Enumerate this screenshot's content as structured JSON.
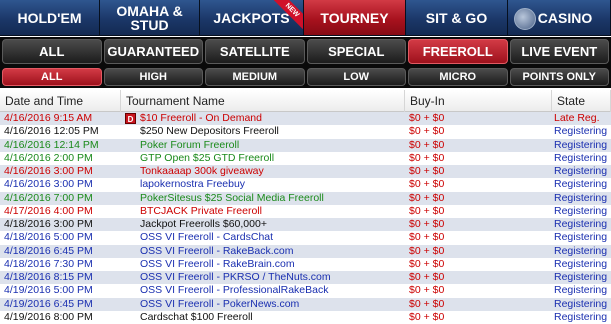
{
  "nav": {
    "tabs": [
      {
        "label": "HOLD'EM",
        "width": 100,
        "active": false
      },
      {
        "label": "OMAHA & STUD",
        "width": 100,
        "active": false
      },
      {
        "label": "JACKPOTS",
        "width": 104,
        "active": false,
        "ribbon": "NEW"
      },
      {
        "label": "TOURNEY",
        "width": 102,
        "active": true
      },
      {
        "label": "SIT & GO",
        "width": 102,
        "active": false
      },
      {
        "label": "CASINO",
        "width": 103,
        "active": false,
        "logo": "casino-logo-icon"
      }
    ]
  },
  "filters": {
    "types": [
      {
        "label": "ALL",
        "active": false
      },
      {
        "label": "GUARANTEED",
        "active": false
      },
      {
        "label": "SATELLITE",
        "active": false
      },
      {
        "label": "SPECIAL",
        "active": false
      },
      {
        "label": "FREEROLL",
        "active": true
      },
      {
        "label": "LIVE EVENT",
        "active": false
      }
    ],
    "stakes": [
      {
        "label": "ALL",
        "active": true
      },
      {
        "label": "HIGH",
        "active": false
      },
      {
        "label": "MEDIUM",
        "active": false
      },
      {
        "label": "LOW",
        "active": false
      },
      {
        "label": "MICRO",
        "active": false
      },
      {
        "label": "POINTS ONLY",
        "active": false
      }
    ]
  },
  "table": {
    "columns": [
      "Date and Time",
      "Tournament Name",
      "Buy-In",
      "State"
    ],
    "rows": [
      {
        "date": "4/16/2016 9:15 AM",
        "name": "$10 Freeroll - On Demand",
        "buyin": "$0 + $0",
        "state": "Late Reg.",
        "color": "#cc0000",
        "badge": "D"
      },
      {
        "date": "4/16/2016 12:05 PM",
        "name": "$250 New Depositors Freeroll",
        "buyin": "$0 + $0",
        "state": "Registering",
        "color": "#111111"
      },
      {
        "date": "4/16/2016 12:14 PM",
        "name": "Poker Forum Freeroll",
        "buyin": "$0 + $0",
        "state": "Registering",
        "color": "#1a8a1a"
      },
      {
        "date": "4/16/2016 2:00 PM",
        "name": "GTP Open $25 GTD Freeroll",
        "buyin": "$0 + $0",
        "state": "Registering",
        "color": "#1a8a1a"
      },
      {
        "date": "4/16/2016 3:00 PM",
        "name": "Tonkaaaap 300k giveaway",
        "buyin": "$0 + $0",
        "state": "Registering",
        "color": "#cc0000"
      },
      {
        "date": "4/16/2016 3:00 PM",
        "name": "lapokernostra Freebuy",
        "buyin": "$0 + $0",
        "state": "Registering",
        "color": "#1a2fb0"
      },
      {
        "date": "4/16/2016 7:00 PM",
        "name": "PokerSitesus $25 Social Media Freeroll",
        "buyin": "$0 + $0",
        "state": "Registering",
        "color": "#1a8a1a"
      },
      {
        "date": "4/17/2016 4:00 PM",
        "name": "BTCJACK Private Freeroll",
        "buyin": "$0 + $0",
        "state": "Registering",
        "color": "#cc0000"
      },
      {
        "date": "4/18/2016 3:00 PM",
        "name": "Jackpot Freerolls $60,000+",
        "buyin": "$0 + $0",
        "state": "Registering",
        "color": "#111111"
      },
      {
        "date": "4/18/2016 5:00 PM",
        "name": "OSS VI Freeroll - CardsChat",
        "buyin": "$0 + $0",
        "state": "Registering",
        "color": "#1a2fb0"
      },
      {
        "date": "4/18/2016 6:45 PM",
        "name": "OSS VI Freeroll - RakeBack.com",
        "buyin": "$0 + $0",
        "state": "Registering",
        "color": "#1a2fb0"
      },
      {
        "date": "4/18/2016 7:30 PM",
        "name": "OSS VI Freeroll - RakeBrain.com",
        "buyin": "$0 + $0",
        "state": "Registering",
        "color": "#1a2fb0"
      },
      {
        "date": "4/18/2016 8:15 PM",
        "name": "OSS VI Freeroll - PKRSO / TheNuts.com",
        "buyin": "$0 + $0",
        "state": "Registering",
        "color": "#1a2fb0"
      },
      {
        "date": "4/19/2016 5:00 PM",
        "name": "OSS VI Freeroll - ProfessionalRakeBack",
        "buyin": "$0 + $0",
        "state": "Registering",
        "color": "#1a2fb0"
      },
      {
        "date": "4/19/2016 6:45 PM",
        "name": "OSS VI Freeroll - PokerNews.com",
        "buyin": "$0 + $0",
        "state": "Registering",
        "color": "#1a2fb0"
      },
      {
        "date": "4/19/2016 8:00 PM",
        "name": "Cardschat $100 Freeroll",
        "buyin": "$0 + $0",
        "state": "Registering",
        "color": "#111111"
      }
    ]
  },
  "colors": {
    "active_red": "#a8121e",
    "nav_blue": "#1b3768",
    "buyin_red": "#cc0000"
  }
}
